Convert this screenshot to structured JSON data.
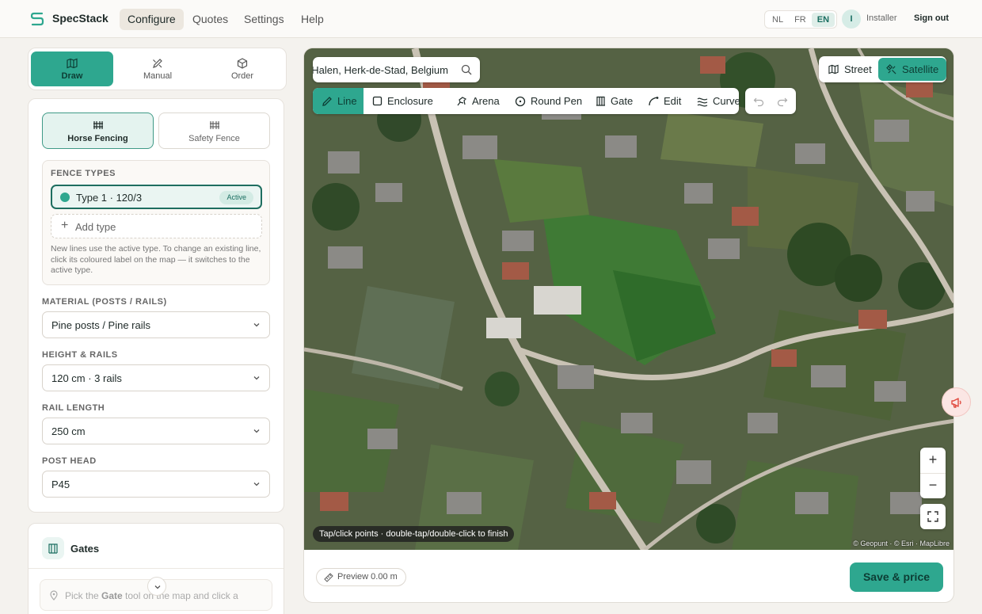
{
  "brand": {
    "name": "SpecStack"
  },
  "nav": {
    "configure": "Configure",
    "quotes": "Quotes",
    "settings": "Settings",
    "help": "Help"
  },
  "lang": [
    "NL",
    "FR",
    "EN"
  ],
  "user": {
    "initial": "I",
    "role": "Installer",
    "signout": "Sign out"
  },
  "mode_tabs": {
    "draw": "Draw",
    "manual": "Manual",
    "order": "Order"
  },
  "products": {
    "horse": "Horse Fencing",
    "safety": "Safety Fence"
  },
  "fence_types": {
    "label": "FENCE TYPES",
    "active_type": "Type 1 · 120/3",
    "active_badge": "Active",
    "add_type": "Add type",
    "help": "New lines use the active type. To change an existing line, click its coloured label on the map — it switches to the active type."
  },
  "material": {
    "label": "MATERIAL (POSTS / RAILS)",
    "value": "Pine posts / Pine rails"
  },
  "height": {
    "label": "HEIGHT & RAILS",
    "value": "120 cm · 3 rails"
  },
  "rail_length": {
    "label": "RAIL LENGTH",
    "value": "250 cm"
  },
  "post_head": {
    "label": "POST HEAD",
    "value": "P45"
  },
  "gates": {
    "title": "Gates",
    "hint_pre": "Pick the ",
    "hint_bold": "Gate",
    "hint_post": " tool on the map and click a"
  },
  "map": {
    "search_value": "Halen, Herk-de-Stad, Belgium",
    "tools": {
      "line": "Line",
      "enclosure": "Enclosure",
      "arena": "Arena",
      "round_pen": "Round Pen",
      "gate": "Gate",
      "edit": "Edit",
      "curve": "Curve"
    },
    "layers": {
      "street": "Street",
      "satellite": "Satellite"
    },
    "hint": "Tap/click points · double-tap/double-click to finish",
    "attribution": "© Geopunt · © Esri · MapLibre",
    "preview": "Preview 0.00 m",
    "save": "Save & price"
  },
  "colors": {
    "accent": "#2ea78f",
    "accent_dark": "#1a6e61",
    "danger": "#e04a3f"
  }
}
